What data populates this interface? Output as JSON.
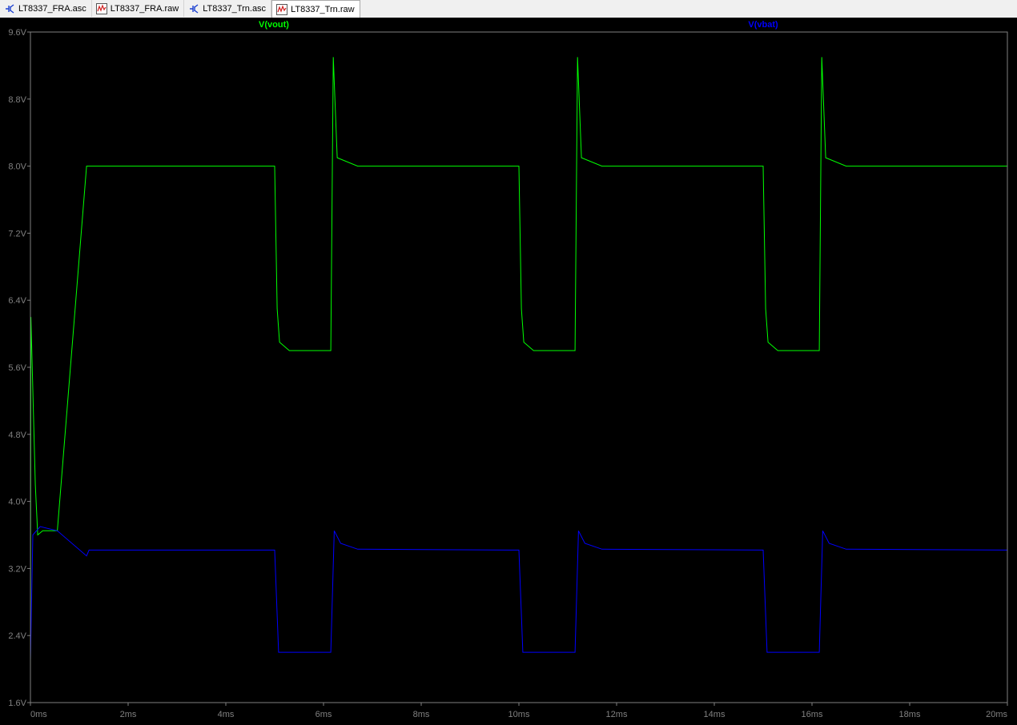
{
  "tabs": [
    {
      "label": "LT8337_FRA.asc",
      "icon": "schematic-icon",
      "active": false
    },
    {
      "label": "LT8337_FRA.raw",
      "icon": "waveform-icon",
      "active": false
    },
    {
      "label": "LT8337_Trn.asc",
      "icon": "schematic-icon",
      "active": false
    },
    {
      "label": "LT8337_Trn.raw",
      "icon": "waveform-icon",
      "active": true
    }
  ],
  "colors": {
    "background": "#000000",
    "axis_text": "#808080",
    "frame": "#808080",
    "vout": "#00ff00",
    "vbat": "#0000ff"
  },
  "chart_data": {
    "type": "line",
    "xlim": [
      0,
      20
    ],
    "ylim": [
      1.6,
      9.6
    ],
    "x_ticks": [
      "0ms",
      "2ms",
      "4ms",
      "6ms",
      "8ms",
      "10ms",
      "12ms",
      "14ms",
      "16ms",
      "18ms",
      "20ms"
    ],
    "y_ticks": [
      "1.6V",
      "2.4V",
      "3.2V",
      "4.0V",
      "4.8V",
      "5.6V",
      "6.4V",
      "7.2V",
      "8.0V",
      "8.8V",
      "9.6V"
    ],
    "grid": false,
    "legend": "top",
    "series": [
      {
        "name": "V(vout)",
        "color": "#00ff00",
        "points": [
          [
            0,
            2.0
          ],
          [
            0.01,
            6.2
          ],
          [
            0.1,
            4.2
          ],
          [
            0.15,
            3.6
          ],
          [
            0.25,
            3.65
          ],
          [
            0.55,
            3.65
          ],
          [
            1.15,
            8.0
          ],
          [
            5.0,
            8.0
          ],
          [
            5.05,
            6.3
          ],
          [
            5.1,
            5.9
          ],
          [
            5.3,
            5.8
          ],
          [
            6.15,
            5.8
          ],
          [
            6.2,
            9.3
          ],
          [
            6.28,
            8.1
          ],
          [
            6.7,
            8.0
          ],
          [
            10.0,
            8.0
          ],
          [
            10.05,
            6.3
          ],
          [
            10.1,
            5.9
          ],
          [
            10.3,
            5.8
          ],
          [
            11.15,
            5.8
          ],
          [
            11.2,
            9.3
          ],
          [
            11.28,
            8.1
          ],
          [
            11.7,
            8.0
          ],
          [
            15.0,
            8.0
          ],
          [
            15.05,
            6.3
          ],
          [
            15.1,
            5.9
          ],
          [
            15.3,
            5.8
          ],
          [
            16.15,
            5.8
          ],
          [
            16.2,
            9.3
          ],
          [
            16.28,
            8.1
          ],
          [
            16.7,
            8.0
          ],
          [
            20,
            8.0
          ]
        ]
      },
      {
        "name": "V(vbat)",
        "color": "#0000ff",
        "points": [
          [
            0,
            2.1
          ],
          [
            0.05,
            3.6
          ],
          [
            0.2,
            3.7
          ],
          [
            0.55,
            3.65
          ],
          [
            1.15,
            3.35
          ],
          [
            1.2,
            3.42
          ],
          [
            5.0,
            3.42
          ],
          [
            5.08,
            2.2
          ],
          [
            6.15,
            2.2
          ],
          [
            6.22,
            3.65
          ],
          [
            6.35,
            3.5
          ],
          [
            6.7,
            3.43
          ],
          [
            10.0,
            3.42
          ],
          [
            10.08,
            2.2
          ],
          [
            11.15,
            2.2
          ],
          [
            11.22,
            3.65
          ],
          [
            11.35,
            3.5
          ],
          [
            11.7,
            3.43
          ],
          [
            15.0,
            3.42
          ],
          [
            15.08,
            2.2
          ],
          [
            16.15,
            2.2
          ],
          [
            16.22,
            3.65
          ],
          [
            16.35,
            3.5
          ],
          [
            16.7,
            3.43
          ],
          [
            20,
            3.42
          ]
        ]
      }
    ]
  }
}
